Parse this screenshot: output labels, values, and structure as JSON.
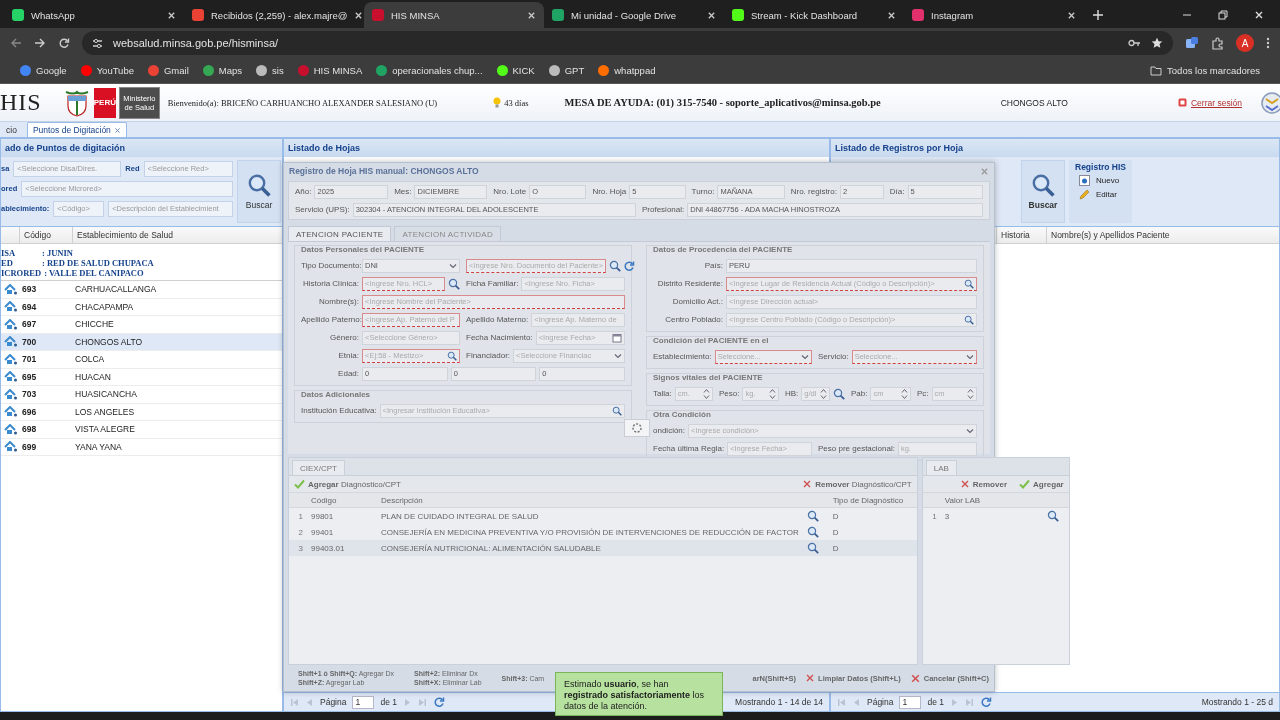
{
  "browser": {
    "tabs": [
      {
        "title": "WhatsApp",
        "selected": false
      },
      {
        "title": "Recibidos (2,259) - alex.majre@",
        "selected": false
      },
      {
        "title": "HIS MINSA",
        "selected": true
      },
      {
        "title": "Mi unidad - Google Drive",
        "selected": false
      },
      {
        "title": "Stream - Kick Dashboard",
        "selected": false
      },
      {
        "title": "Instagram",
        "selected": false
      }
    ],
    "address": "websalud.minsa.gob.pe/hisminsa/",
    "profile": "A",
    "bookmarks": [
      "Google",
      "YouTube",
      "Gmail",
      "Maps",
      "sis",
      "HIS MINSA",
      "operacionales chup...",
      "KICK",
      "GPT",
      "whatppad"
    ],
    "all_bookmarks": "Todos los marcadores"
  },
  "header": {
    "logo": "HIS",
    "country": "PERÚ",
    "ministry": "Ministerio de Salud",
    "welcome": "Bienvenido(a): BRICEÑO CARHUANCHO ALEXANDER SALESIANO (U)",
    "days": "43 días",
    "help": "MESA DE AYUDA: (01) 315-7540 - soporte_aplicativos@minsa.gob.pe",
    "establishment": "CHONGOS ALTO",
    "logout": "Cerrar sesión"
  },
  "app_tabs": [
    {
      "label": "cio",
      "selected": false,
      "closable": false
    },
    {
      "label": "Puntos de Digitación",
      "selected": true,
      "closable": true
    }
  ],
  "points_panel": {
    "title": "ado de Puntos de digitación",
    "filters": [
      [
        {
          "label": "sa",
          "placeholder": "<Seleccione Disa/Dires."
        },
        {
          "label": "Red",
          "placeholder": "<Seleccione Red>"
        }
      ],
      [
        {
          "label": "ored",
          "placeholder": "<Seleccione Microred>"
        }
      ],
      [
        {
          "label": "ablecimiento:",
          "placeholder": "<Código>"
        },
        {
          "placeholder": "<Descripción del Establecimient"
        }
      ]
    ],
    "search_button": "Buscar",
    "columns": [
      "Código",
      "Establecimiento de Salud"
    ],
    "group": [
      {
        "label": "ISA",
        "value": ": JUNIN"
      },
      {
        "label": "ED",
        "value": ": RED DE SALUD CHUPACA"
      },
      {
        "label": "ICRORED",
        "value": ": VALLE DEL CANIPACO"
      }
    ],
    "rows": [
      {
        "code": "693",
        "name": "CARHUACALLANGA",
        "selected": false
      },
      {
        "code": "694",
        "name": "CHACAPAMPA",
        "selected": false
      },
      {
        "code": "697",
        "name": "CHICCHE",
        "selected": false
      },
      {
        "code": "700",
        "name": "CHONGOS ALTO",
        "selected": true
      },
      {
        "code": "701",
        "name": "COLCA",
        "selected": false
      },
      {
        "code": "695",
        "name": "HUACAN",
        "selected": false
      },
      {
        "code": "703",
        "name": "HUASICANCHA",
        "selected": false
      },
      {
        "code": "696",
        "name": "LOS ANGELES",
        "selected": false
      },
      {
        "code": "698",
        "name": "VISTA ALEGRE",
        "selected": false
      },
      {
        "code": "699",
        "name": "YANA YANA",
        "selected": false
      }
    ]
  },
  "sheets_panel": {
    "title": "Listado de Hojas",
    "pager": {
      "page_label": "Página",
      "page": "1",
      "of": "de 1",
      "summary": "Mostrando 1 - 14 de 14"
    }
  },
  "records_panel": {
    "title": "Listado de Registros por Hoja",
    "search_button": "Buscar",
    "group_title": "Registro HIS",
    "actions": [
      {
        "label": "Nuevo",
        "kind": "new"
      },
      {
        "label": "Editar",
        "kind": "edit"
      }
    ],
    "columns": [
      "Historia",
      "Nombre(s) y Apellidos Paciente"
    ],
    "pager": {
      "page_label": "Página",
      "page": "1",
      "of": "de 1",
      "summary": "Mostrando 1 - 25 d"
    }
  },
  "modal": {
    "title": "Registro de Hoja HIS manual: CHONGOS ALTO",
    "sheet_fields": [
      [
        {
          "label": "Año:",
          "value": "2025"
        },
        {
          "label": "Mes:",
          "value": "DICIEMBRE"
        },
        {
          "label": "Nro. Lote",
          "value": "O"
        },
        {
          "label": "Nro. Hoja",
          "value": "5"
        },
        {
          "label": "Turno:",
          "value": "MAÑANA"
        },
        {
          "label": "Nro. registro:",
          "value": "2"
        },
        {
          "label": "Día:",
          "value": "5"
        }
      ],
      [
        {
          "label": "Servicio (UPS):",
          "value": "302304 - ATENCION INTEGRAL DEL ADOLESCENTE"
        },
        {
          "label": "Profesional:",
          "value": "DNI 44867756 - ADA MACHA HINOSTROZA"
        }
      ]
    ],
    "tabs": [
      {
        "label": "ATENCION PACIENTE",
        "selected": true
      },
      {
        "label": "ATENCION ACTIVIDAD",
        "selected": false
      }
    ],
    "left_sections": [
      {
        "title": "Datos Personales del PACIENTE",
        "rows": [
          [
            {
              "label": "Tipo Documento:",
              "value": "DNI",
              "kind": "combo",
              "required": false
            },
            {
              "placeholder": "<Ingrese Nro. Documento del Paciente>",
              "kind": "lookup-refresh",
              "required": true
            }
          ],
          [
            {
              "label": "Historia Clínica:",
              "placeholder": "<Ingrese Nro. HCL>",
              "kind": "lookup",
              "required": true
            },
            {
              "label": "Ficha Familiar:",
              "placeholder": "<Ingrese Nro. Ficha>",
              "kind": "text",
              "required": false
            }
          ],
          [
            {
              "label": "Nombre(s):",
              "placeholder": "<Ingrese Nombre del Paciente>",
              "kind": "text",
              "required": true
            }
          ],
          [
            {
              "label": "Apellido Paterno:",
              "placeholder": "<Ingrese Ap. Paterno del P",
              "kind": "text",
              "required": true
            },
            {
              "label": "Apellido Materno:",
              "placeholder": "<Ingrese Ap. Materno de",
              "kind": "text",
              "required": false
            }
          ],
          [
            {
              "label": "Género:",
              "placeholder": "<Seleccione Género>",
              "kind": "text",
              "required": false
            },
            {
              "label": "Fecha Nacimiento:",
              "placeholder": "<Ingrese Fecha>",
              "kind": "date",
              "required": false
            }
          ],
          [
            {
              "label": "Etnia:",
              "placeholder": "<Ej:58 - Mestizo>",
              "kind": "search",
              "required": true
            },
            {
              "label": "Financiador:",
              "placeholder": "<Seleccione Financiac",
              "kind": "combo",
              "required": false
            }
          ],
          [
            {
              "label": "Edad:",
              "values": [
                "0",
                "0",
                "0"
              ],
              "kind": "multi",
              "required": false
            }
          ]
        ]
      },
      {
        "title": "Datos Adicionales",
        "rows": [
          [
            {
              "label": "Institución Educativa:",
              "placeholder": "<Ingresar Institución Educativa>",
              "kind": "search",
              "required": false
            }
          ]
        ]
      }
    ],
    "right_sections": [
      {
        "title": "Datos de Procedencia del PACIENTE",
        "rows": [
          [
            {
              "label": "País:",
              "value": "PERU",
              "kind": "text",
              "required": false
            }
          ],
          [
            {
              "label": "Distrito Residente:",
              "placeholder": "<Ingrese Lugar de Residencia Actual (Código o Descripción)>",
              "kind": "search",
              "required": true
            }
          ],
          [
            {
              "label": "Domicilio Act.:",
              "placeholder": "<Ingrese Dirección actual>",
              "kind": "text",
              "required": false
            }
          ],
          [
            {
              "label": "Centro Poblado:",
              "placeholder": "<Ingrese Centro Poblado (Código o Descripción)>",
              "kind": "search",
              "required": false
            }
          ]
        ]
      },
      {
        "title": "Condición del PACIENTE en el",
        "rows": [
          [
            {
              "label": "Establecimiento:",
              "placeholder": "Seleccione...",
              "kind": "combo",
              "required": true
            },
            {
              "label": "Servicio:",
              "placeholder": "Seleccione...",
              "kind": "combo",
              "required": true
            }
          ]
        ]
      },
      {
        "title": "Signos vitales del PACIENTE",
        "rows": [
          [
            {
              "label": "Talla:",
              "placeholder": "cm.",
              "kind": "spin",
              "required": false
            },
            {
              "label": "Peso:",
              "placeholder": "kg.",
              "kind": "spin",
              "required": false
            },
            {
              "label": "HB:",
              "placeholder": "g/dl",
              "kind": "spin-lookup",
              "required": false
            },
            {
              "label": "Pab:",
              "placeholder": "cm",
              "kind": "spin",
              "required": false
            },
            {
              "label": "Pc:",
              "placeholder": "cm",
              "kind": "spin",
              "required": false
            }
          ]
        ]
      },
      {
        "title": "Otra Condición",
        "rows": [
          [
            {
              "label": "ondición:",
              "placeholder": "<Ingrese condición>",
              "kind": "combo",
              "required": false
            }
          ],
          [
            {
              "label": "Fecha última Regla:",
              "placeholder": "<Ingrese Fecha>",
              "kind": "text",
              "required": false
            },
            {
              "label": "Peso pre gestacional:",
              "placeholder": "kg.",
              "kind": "text",
              "required": false
            }
          ]
        ]
      }
    ],
    "ciex": {
      "tab": "CIEX/CPT",
      "add": "**Agregar** Diagnóstico/CPT",
      "remove": "**Remover** Diagnóstico/CPT",
      "columns": [
        "Código",
        "Descripción",
        "Tipo de Diagnóstico"
      ],
      "rows": [
        {
          "n": "1",
          "code": "99801",
          "description": "PLAN DE CUIDADO INTEGRAL DE SALUD",
          "type": "D",
          "selected": false
        },
        {
          "n": "2",
          "code": "99401",
          "description": "CONSEJERÍA EN MEDICINA PREVENTIVA Y/O PROVISIÓN DE INTERVENCIONES DE REDUCCIÓN DE FACTOR",
          "type": "D",
          "selected": false
        },
        {
          "n": "3",
          "code": "99403.01",
          "description": "CONSEJERÍA NUTRICIONAL: ALIMENTACIÓN SALUDABLE",
          "type": "D",
          "selected": true
        }
      ]
    },
    "lab": {
      "tab": "LAB",
      "remove": "Remover",
      "add": "Agregar",
      "columns": [
        "Valor LAB"
      ],
      "rows": [
        {
          "n": "1",
          "value": "3",
          "selected": false
        }
      ]
    },
    "shortcuts": [
      [
        "**Shift+1 ó Shift+Q:** Agregar Dx",
        "**Shift+Z:** Agregar Lab"
      ],
      [
        "**Shift+2:** Eliminar Dx",
        "**Shift+X:** Eliminar Lab"
      ],
      [
        "**Shift+3:** Cam"
      ]
    ],
    "buttons": [
      {
        "label": "arN(Shift+S)",
        "kind": "partial"
      },
      {
        "label": "Limpiar Datos (Shift+L)",
        "kind": "clear"
      },
      {
        "label": "Cancelar (Shift+C)",
        "kind": "cancel"
      }
    ]
  },
  "toast": "Estimado **usuario**, se han **registrado satisfactoriamente** los datos de la atención."
}
